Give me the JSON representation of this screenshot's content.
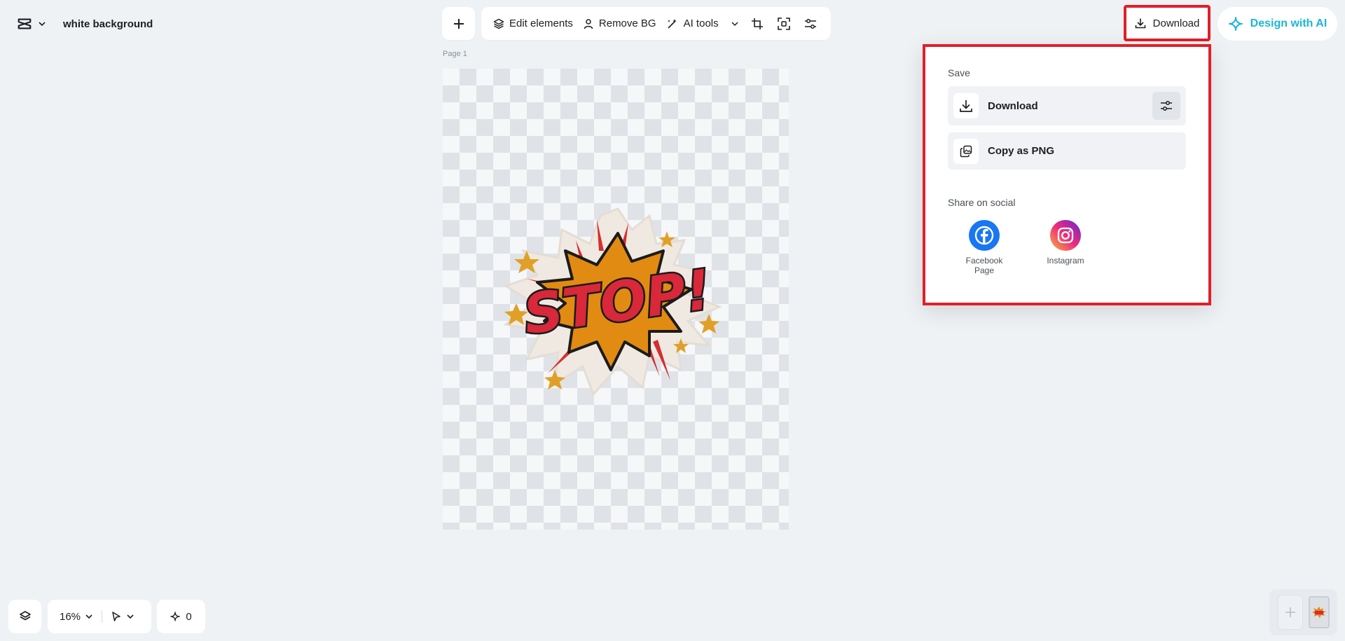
{
  "header": {
    "logo_icon": "capcut-logo-icon",
    "document_title": "white background"
  },
  "toolbar": {
    "add_icon": "plus-icon",
    "edit_elements_label": "Edit elements",
    "remove_bg_label": "Remove BG",
    "ai_tools_label": "AI tools",
    "crop_icon": "crop-icon",
    "resize_icon": "resize-icon",
    "adjust_icon": "adjust-icon"
  },
  "top_right": {
    "download_label": "Download",
    "design_ai_label": "Design with AI",
    "accent_color": "#18b7d6",
    "highlight_color": "#e0202a"
  },
  "canvas": {
    "page_label": "Page 1",
    "sticker_text": "STOP!"
  },
  "download_panel": {
    "save_heading": "Save",
    "download_option": "Download",
    "copy_png_option": "Copy as PNG",
    "share_heading": "Share on social",
    "social": [
      {
        "name_line1": "Facebook",
        "name_line2": "Page",
        "color": "#1877f2"
      },
      {
        "name_line1": "Instagram",
        "name_line2": ""
      }
    ]
  },
  "bottom": {
    "zoom": "16%",
    "comments_count": "0"
  }
}
